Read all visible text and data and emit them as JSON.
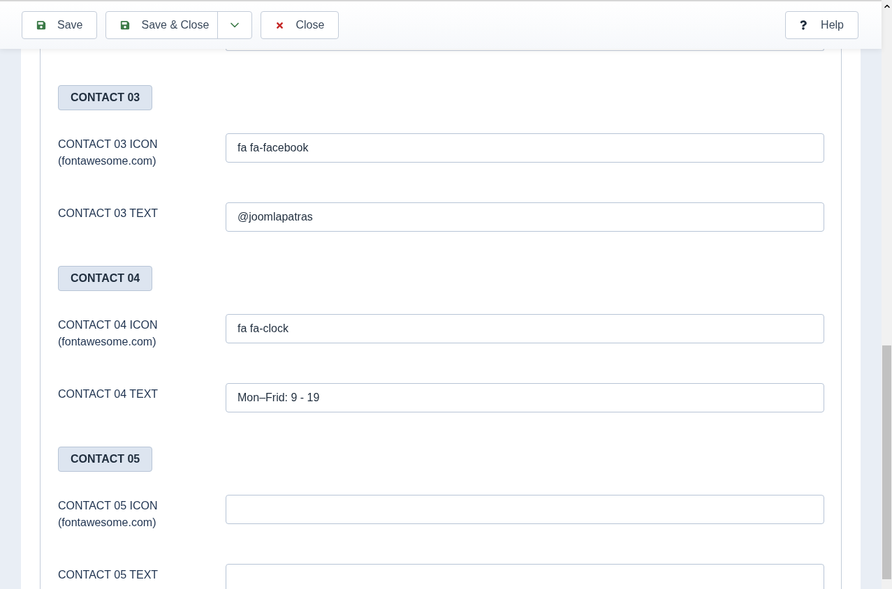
{
  "toolbar": {
    "buttons": [
      {
        "kind": "save",
        "label": "Save"
      },
      {
        "kind": "save_split",
        "label": "Save & Close"
      },
      {
        "kind": "close",
        "label": "Close"
      }
    ],
    "help": {
      "label": "Help"
    }
  },
  "sections": [
    {
      "heading": "CONTACT 03",
      "fields": [
        {
          "label": "CONTACT 03 ICON (fontawesome.com)",
          "value": "fa fa-facebook"
        },
        {
          "label": "CONTACT 03 TEXT",
          "value": "@joomlapatras"
        }
      ]
    },
    {
      "heading": "CONTACT 04",
      "fields": [
        {
          "label": "CONTACT 04 ICON (fontawesome.com)",
          "value": "fa fa-clock"
        },
        {
          "label": "CONTACT 04 TEXT",
          "value": "Mon–Frid: 9 - 19"
        }
      ]
    },
    {
      "heading": "CONTACT 05",
      "fields": [
        {
          "label": "CONTACT 05 ICON (fontawesome.com)"
        },
        {
          "label": "CONTACT 05 TEXT"
        }
      ]
    }
  ]
}
